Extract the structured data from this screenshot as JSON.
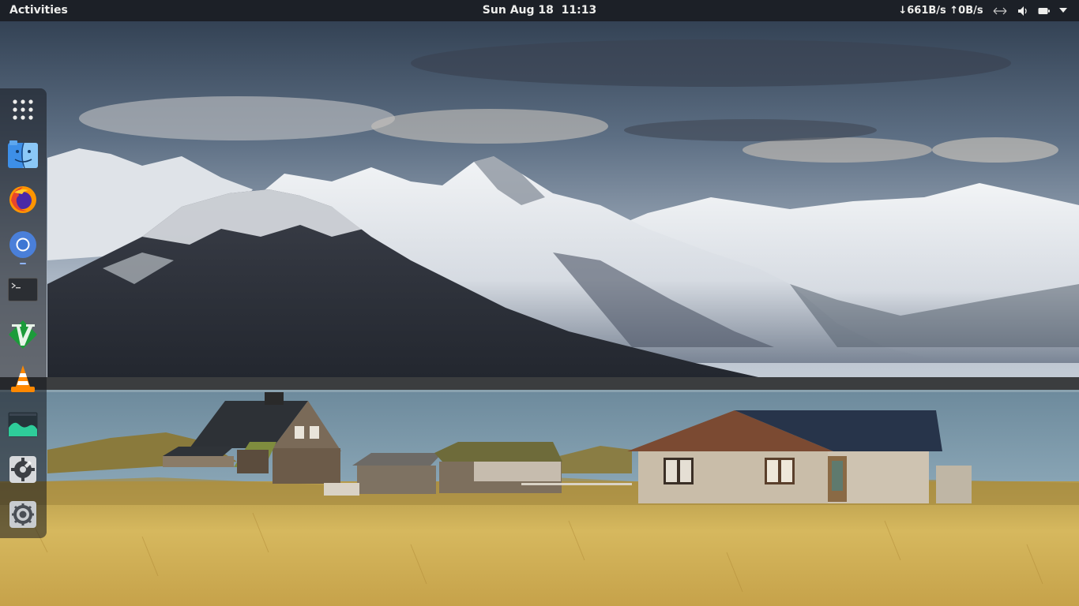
{
  "top_bar": {
    "activities_label": "Activities",
    "clock": "Sun Aug 18  11:13",
    "network_speed": "↓661B/s ↑0B/s",
    "tray_icons": [
      "network-wired-icon",
      "volume-icon",
      "battery-icon",
      "chevron-down-icon"
    ]
  },
  "dock": {
    "items": [
      {
        "icon": "app-grid-icon",
        "running": false
      },
      {
        "icon": "file-manager-icon",
        "running": false
      },
      {
        "icon": "firefox-icon",
        "running": false
      },
      {
        "icon": "chromium-icon",
        "running": true
      },
      {
        "icon": "terminal-icon",
        "running": false
      },
      {
        "icon": "vim-icon",
        "running": false
      },
      {
        "icon": "vlc-icon",
        "running": false
      },
      {
        "icon": "system-monitor-icon",
        "running": false
      },
      {
        "icon": "preferences-icon",
        "running": false
      },
      {
        "icon": "settings-icon",
        "running": false
      }
    ]
  },
  "colors": {
    "top_bar_background": "#1c2027",
    "top_bar_text": "#eeeeec",
    "dock_background": "rgba(22,24,30,0.55)"
  }
}
